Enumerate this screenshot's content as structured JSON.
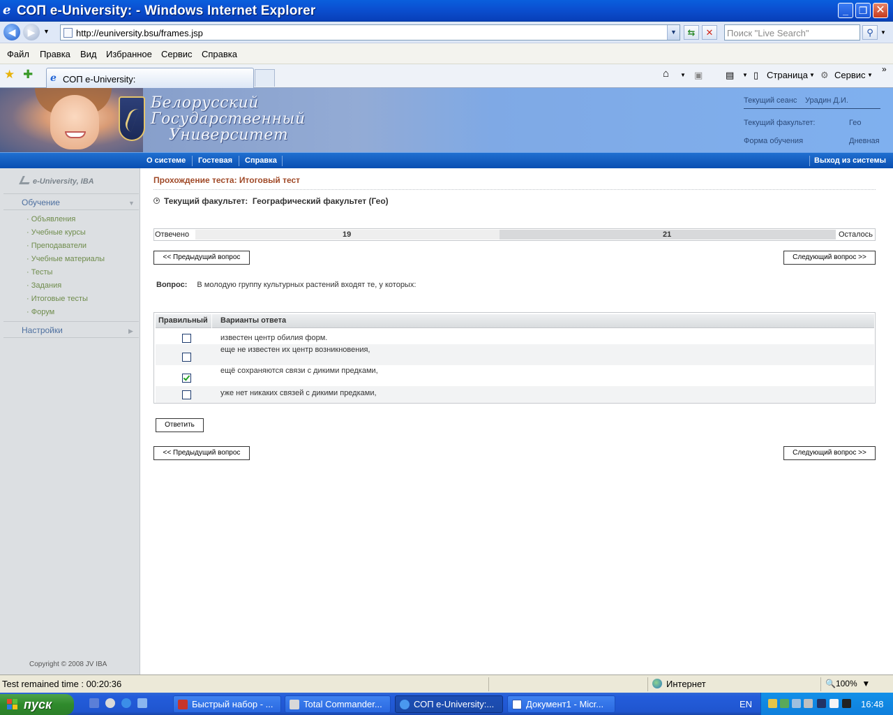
{
  "window": {
    "title": "СОП e-University:  - Windows Internet Explorer"
  },
  "address": {
    "url": "http://euniversity.bsu/frames.jsp",
    "search_placeholder": "Поиск \"Live Search\""
  },
  "menu": {
    "items": [
      "Файл",
      "Правка",
      "Вид",
      "Избранное",
      "Сервис",
      "Справка"
    ]
  },
  "tabs": {
    "active_title": "СОП e-University:",
    "commands": {
      "page": "Страница",
      "tools": "Сервис"
    }
  },
  "banner": {
    "university_lines": [
      "Белорусский",
      "Государственный",
      "Университет"
    ],
    "session_label": "Текущий сеанс",
    "session_user": "Урадин Д.И.",
    "faculty_label": "Текущий факультет:",
    "faculty_value": "Гео",
    "form_label": "Форма обучения",
    "form_value": "Дневная"
  },
  "nav": {
    "items": [
      "О системе",
      "Гостевая",
      "Справка"
    ],
    "logout": "Выход из системы"
  },
  "sidebar": {
    "logo": "e-University, IBA",
    "section_learning": "Обучение",
    "items": [
      "Объявления",
      "Учебные курсы",
      "Преподаватели",
      "Учебные материалы",
      "Тесты",
      "Задания",
      "Итоговые тесты",
      "Форум"
    ],
    "section_settings": "Настройки",
    "copyright": "Copyright © 2008 JV IBA"
  },
  "main": {
    "title": "Прохождение теста: Итоговый тест",
    "faculty_label": "Текущий факультет:",
    "faculty_value": "Географический факультет (Гео)",
    "answered_label": "Отвечено",
    "answered_count": "19",
    "remaining_count": "21",
    "remaining_label": "Осталось",
    "answered_fraction": 0.475,
    "prev_button": "<< Предыдущий вопрос",
    "next_button": "Следующий вопрос >>",
    "question_label": "Вопрос:",
    "question_text": "В молодую группу культурных растений входят   те, у которых:",
    "col_correct": "Правильный",
    "col_options": "Варианты ответа",
    "answers": [
      {
        "text": "известен центр обилия форм.",
        "checked": false
      },
      {
        "text": "еще не известен их  центр возникновения,",
        "checked": false
      },
      {
        "text": "ещё сохраняются связи с дикими предками,",
        "checked": true
      },
      {
        "text": "уже нет никаких связей с дикими предками,",
        "checked": false
      }
    ],
    "submit_button": "Ответить"
  },
  "status": {
    "timer_text": "Test remained time :   00:20:36",
    "zone": "Интернет",
    "zoom": "100%"
  },
  "taskbar": {
    "start": "пуск",
    "tasks": [
      "Быстрый набор - ...",
      "Total Commander...",
      "СОП e-University:...",
      "Документ1 - Micr..."
    ],
    "lang": "EN",
    "clock": "16:48"
  }
}
